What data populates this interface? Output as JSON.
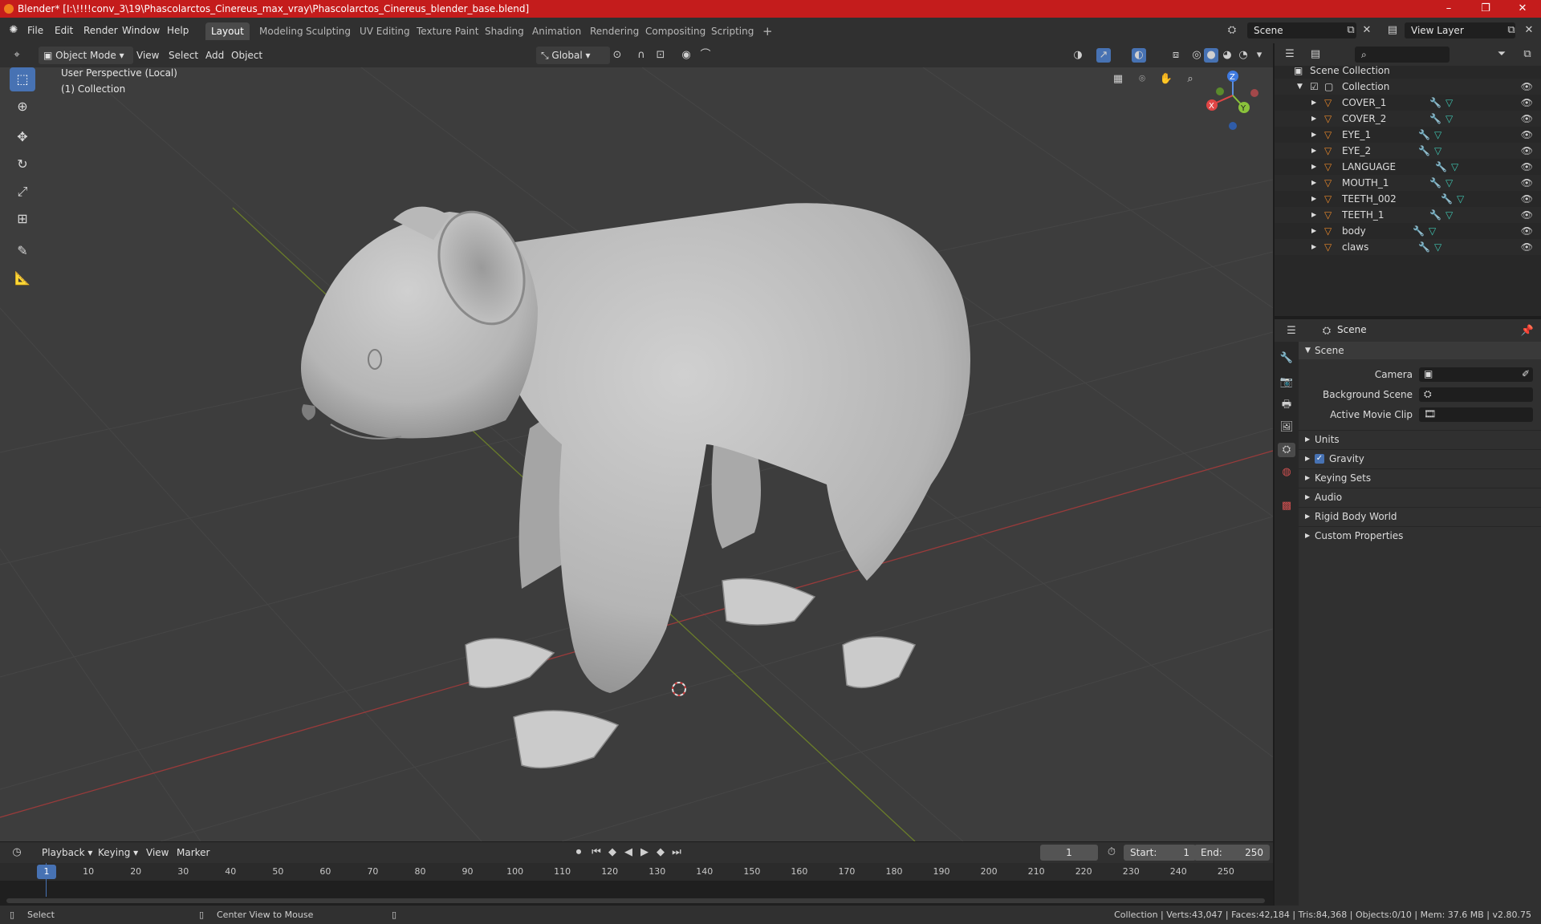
{
  "window": {
    "title": "Blender* [I:\\!!!!conv_3\\19\\Phascolarctos_Cinereus_max_vray\\Phascolarctos_Cinereus_blender_base.blend]",
    "minimize": "–",
    "maximize": "❐",
    "close": "✕"
  },
  "menu": [
    "File",
    "Edit",
    "Render",
    "Window",
    "Help"
  ],
  "workspaces": [
    "Layout",
    "Modeling",
    "Sculpting",
    "UV Editing",
    "Texture Paint",
    "Shading",
    "Animation",
    "Rendering",
    "Compositing",
    "Scripting"
  ],
  "add_workspace": "+",
  "scene_field": "Scene",
  "view_layer_field": "View Layer",
  "viewport_header": {
    "mode": "Object Mode",
    "menus": [
      "View",
      "Select",
      "Add",
      "Object"
    ],
    "transform_orientation": "Global"
  },
  "viewport": {
    "perspective_label": "User Perspective (Local)",
    "collection_label": "(1) Collection",
    "gizmo": {
      "x": "X",
      "y": "Y",
      "z": "Z"
    }
  },
  "outliner": {
    "root": "Scene Collection",
    "collection": "Collection",
    "objects": [
      "COVER_1",
      "COVER_2",
      "EYE_1",
      "EYE_2",
      "LANGUAGE",
      "MOUTH_1",
      "TEETH_002",
      "TEETH_1",
      "body",
      "claws"
    ]
  },
  "properties": {
    "context": "Scene",
    "panel": "Scene",
    "camera_label": "Camera",
    "background_scene_label": "Background Scene",
    "active_movie_clip_label": "Active Movie Clip",
    "sections": [
      "Units",
      "Gravity",
      "Keying Sets",
      "Audio",
      "Rigid Body World",
      "Custom Properties"
    ],
    "gravity_checked": true
  },
  "timeline": {
    "menus": [
      "Playback",
      "Keying",
      "View",
      "Marker"
    ],
    "current_frame": "1",
    "start_label": "Start:",
    "start": "1",
    "end_label": "End:",
    "end": "250",
    "ticks": [
      "1",
      "10",
      "20",
      "30",
      "40",
      "50",
      "60",
      "70",
      "80",
      "90",
      "100",
      "110",
      "120",
      "130",
      "140",
      "150",
      "160",
      "170",
      "180",
      "190",
      "200",
      "210",
      "220",
      "230",
      "240",
      "250"
    ]
  },
  "status": {
    "left_hint": "Select",
    "middle_hint": "Center View to Mouse",
    "stats": "Collection | Verts:43,047 | Faces:42,184 | Tris:84,368 | Objects:0/10 | Mem: 37.6 MB | v2.80.75"
  }
}
